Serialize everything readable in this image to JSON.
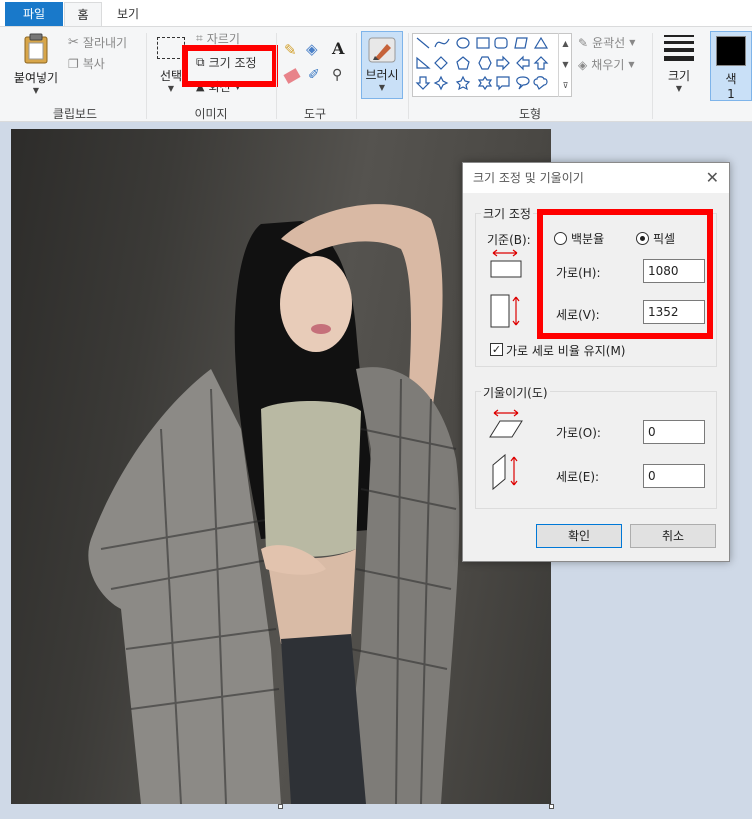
{
  "tabs": {
    "file": "파일",
    "home": "홈",
    "view": "보기"
  },
  "ribbon": {
    "clipboard": {
      "group_label": "클립보드",
      "paste": "붙여넣기",
      "cut": "잘라내기",
      "copy": "복사"
    },
    "image": {
      "group_label": "이미지",
      "select": "선택",
      "crop": "자르기",
      "resize": "크기 조정",
      "rotate": "회전"
    },
    "tools": {
      "group_label": "도구"
    },
    "brushes": {
      "label": "브러시"
    },
    "shapes": {
      "group_label": "도형",
      "outline": "윤곽선",
      "fill": "채우기"
    },
    "size": {
      "label": "크기"
    },
    "color": {
      "label": "색",
      "number": "1"
    }
  },
  "dialog": {
    "title": "크기 조정 및 기울이기",
    "resize_section": "크기 조정",
    "by_label": "기준(B):",
    "percent": "백분율",
    "pixels": "픽셀",
    "horizontal_label": "가로(H):",
    "horizontal_value": "1080",
    "vertical_label": "세로(V):",
    "vertical_value": "1352",
    "keep_ratio": "가로 세로 비율 유지(M)",
    "skew_section": "기울이기(도)",
    "skew_h_label": "가로(O):",
    "skew_h_value": "0",
    "skew_v_label": "세로(E):",
    "skew_v_value": "0",
    "ok": "확인",
    "cancel": "취소"
  },
  "colors": {
    "accent": "#1979ca",
    "highlight": "#ff0000"
  }
}
